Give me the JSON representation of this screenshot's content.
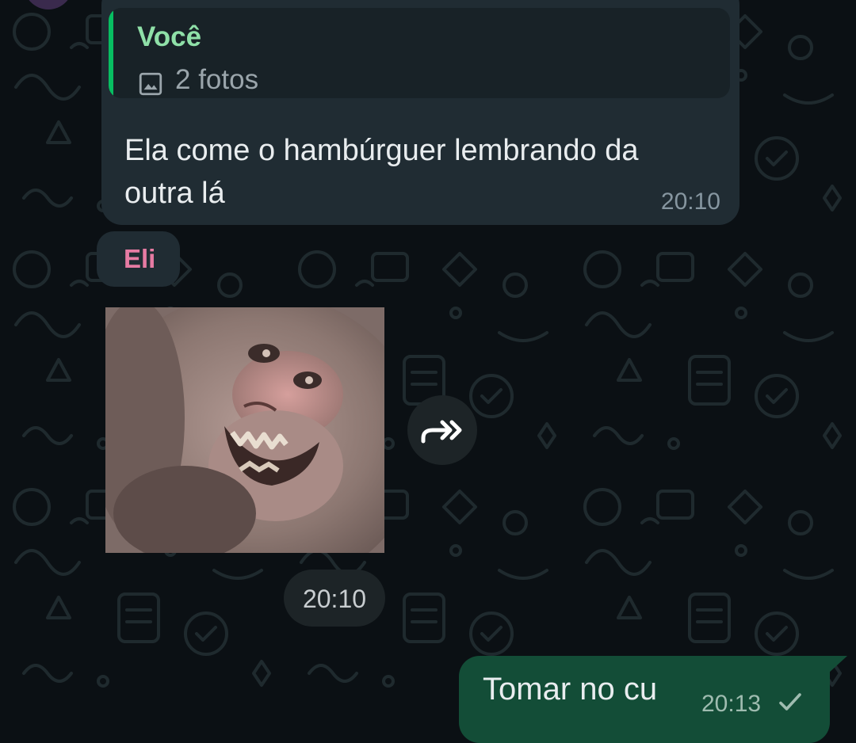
{
  "chat": {
    "quoted_message": {
      "author": "Você",
      "icon": "photo-icon",
      "text": "2 fotos"
    },
    "incoming_message": {
      "text": "Ela come o hambúrguer lembrando da outra lá",
      "time": "20:10"
    },
    "sticker_message": {
      "sender": "Eli",
      "sticker": "grinning-monkey-sticker",
      "time": "20:10"
    },
    "outgoing_message": {
      "text": "Tomar no cu",
      "time": "20:13",
      "status_icon": "single-check-icon"
    }
  },
  "colors": {
    "background": "#0b1014",
    "incoming_bubble": "#202c33",
    "outgoing_bubble": "#134d37",
    "quote_accent": "#06cf68",
    "author_you": "#8fe0a8",
    "author_eli": "#e67ba3"
  }
}
